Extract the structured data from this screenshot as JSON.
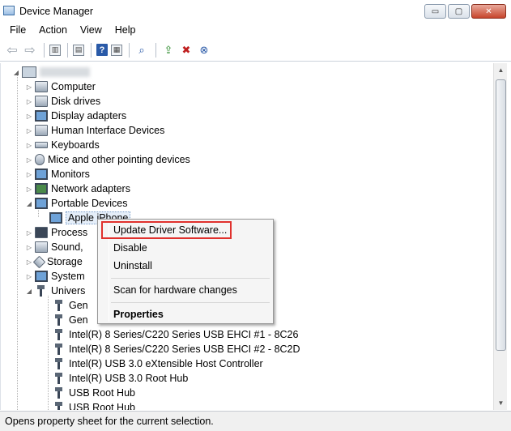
{
  "window": {
    "title": "Device Manager",
    "buttons": {
      "minimize": "▭",
      "maximize": "▢",
      "close": "✕"
    }
  },
  "menubar": [
    "File",
    "Action",
    "View",
    "Help"
  ],
  "toolbar": {
    "icons": [
      "back-arrow-icon",
      "forward-arrow-icon",
      "show-hide-tree-icon",
      "properties-icon",
      "help-icon",
      "view-icon",
      "scan-hardware-icon",
      "update-driver-icon",
      "disable-device-icon",
      "uninstall-device-icon"
    ]
  },
  "tree": {
    "root_label": "",
    "categories": [
      {
        "label": "Computer",
        "icon": "computer-icon",
        "state": "collapsed"
      },
      {
        "label": "Disk drives",
        "icon": "disk-drive-icon",
        "state": "collapsed"
      },
      {
        "label": "Display adapters",
        "icon": "display-adapter-icon",
        "state": "collapsed"
      },
      {
        "label": "Human Interface Devices",
        "icon": "hid-icon",
        "state": "collapsed"
      },
      {
        "label": "Keyboards",
        "icon": "keyboard-icon",
        "state": "collapsed"
      },
      {
        "label": "Mice and other pointing devices",
        "icon": "mouse-icon",
        "state": "collapsed"
      },
      {
        "label": "Monitors",
        "icon": "monitor-icon",
        "state": "collapsed"
      },
      {
        "label": "Network adapters",
        "icon": "network-adapter-icon",
        "state": "collapsed"
      },
      {
        "label": "Portable Devices",
        "icon": "portable-device-icon",
        "state": "expanded"
      }
    ],
    "portable_child": {
      "label": "Apple iPhone",
      "icon": "phone-icon"
    },
    "after_categories": [
      {
        "label": "Process",
        "icon": "processor-icon",
        "state": "collapsed"
      },
      {
        "label": "Sound,",
        "icon": "sound-icon",
        "state": "collapsed"
      },
      {
        "label": "Storage",
        "icon": "storage-icon",
        "state": "collapsed"
      },
      {
        "label": "System",
        "icon": "system-icon",
        "state": "collapsed"
      },
      {
        "label": "Univers",
        "icon": "usb-controller-icon",
        "state": "expanded"
      }
    ],
    "usb_children": [
      "Gen",
      "Gen",
      "Intel(R) 8 Series/C220 Series USB EHCI #1 - 8C26",
      "Intel(R) 8 Series/C220 Series USB EHCI #2 - 8C2D",
      "Intel(R) USB 3.0 eXtensible Host Controller",
      "Intel(R) USB 3.0 Root Hub",
      "USB Root Hub",
      "USB Root Hub"
    ]
  },
  "context_menu": {
    "items": {
      "update": "Update Driver Software...",
      "disable": "Disable",
      "uninstall": "Uninstall",
      "scan": "Scan for hardware changes",
      "properties": "Properties"
    }
  },
  "statusbar": {
    "text": "Opens property sheet for the current selection."
  },
  "colors": {
    "highlight_box": "#e0312d",
    "selection_bg": "#e5eef9"
  }
}
